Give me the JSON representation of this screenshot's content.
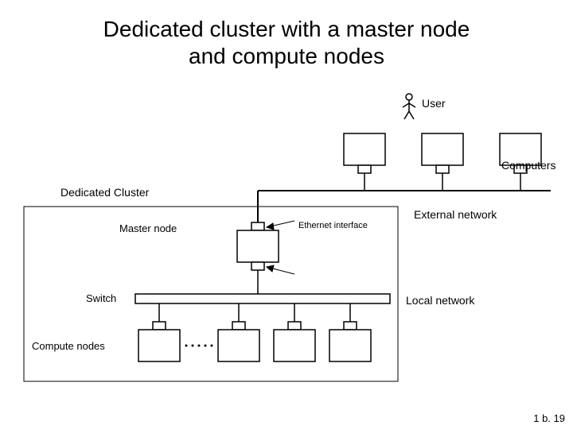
{
  "title_line1": "Dedicated cluster with a master node",
  "title_line2": "and compute nodes",
  "labels": {
    "user": "User",
    "computers": "Computers",
    "dedicated_cluster": "Dedicated Cluster",
    "external_network": "External network",
    "master_node": "Master node",
    "ethernet_interface": "Ethernet interface",
    "switch": "Switch",
    "local_network": "Local network",
    "compute_nodes": "Compute nodes"
  },
  "footer": "1 b. 19"
}
